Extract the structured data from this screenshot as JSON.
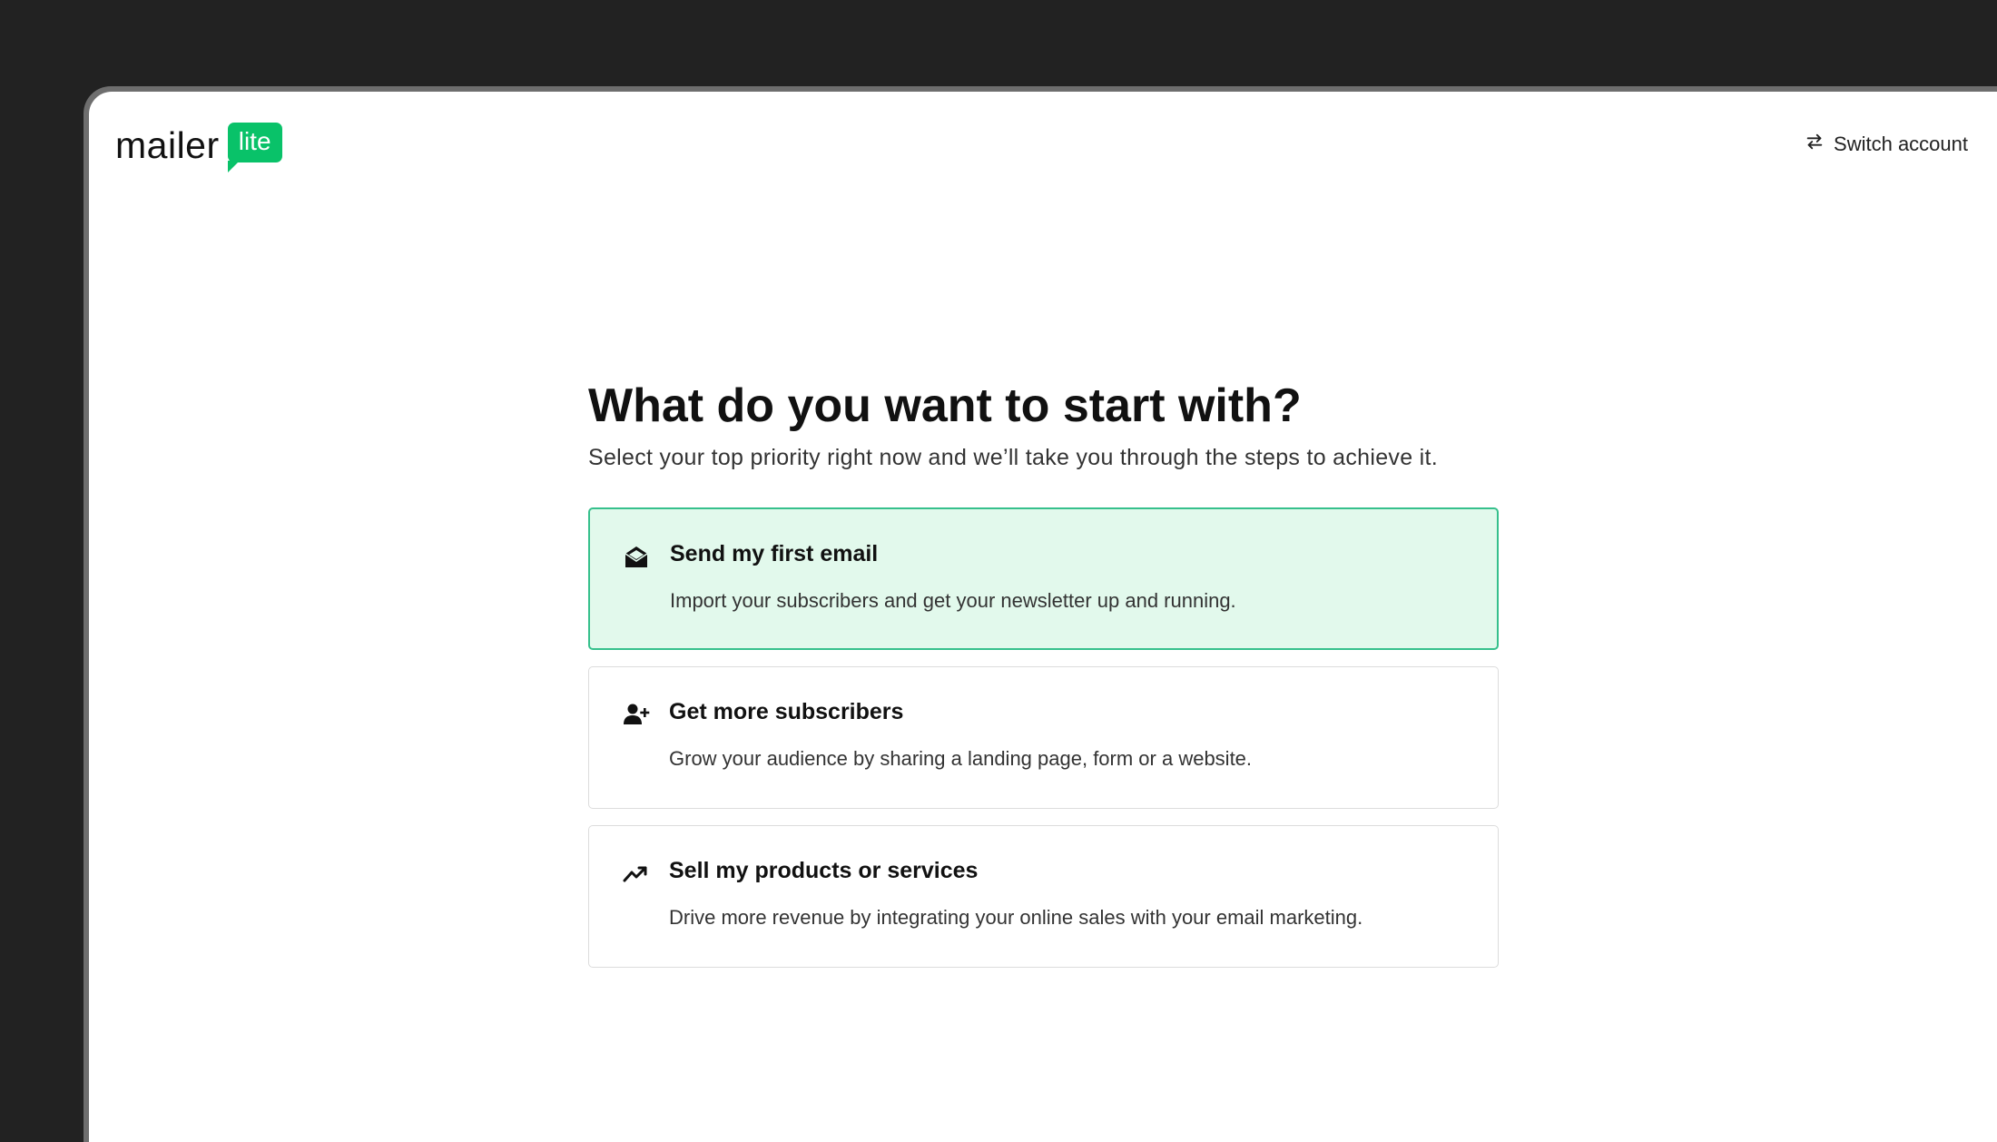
{
  "header": {
    "logo_word": "mailer",
    "logo_badge": "lite",
    "switch_account_label": "Switch account"
  },
  "main": {
    "title": "What do you want to start with?",
    "subtitle": "Select your top priority right now and we’ll take you through the steps to achieve it.",
    "options": [
      {
        "title": "Send my first email",
        "description": "Import your subscribers and get your newsletter up and running.",
        "icon": "envelope-open-icon",
        "selected": true
      },
      {
        "title": "Get more subscribers",
        "description": "Grow your audience by sharing a landing page, form or a website.",
        "icon": "user-plus-icon",
        "selected": false
      },
      {
        "title": "Sell my products or services",
        "description": "Drive more revenue by integrating your online sales with your email marketing.",
        "icon": "trending-up-icon",
        "selected": false
      }
    ]
  },
  "colors": {
    "brand_green": "#09c269",
    "selected_bg": "#e2f9ec",
    "selected_border": "#36c08c",
    "backdrop": "#222222"
  }
}
